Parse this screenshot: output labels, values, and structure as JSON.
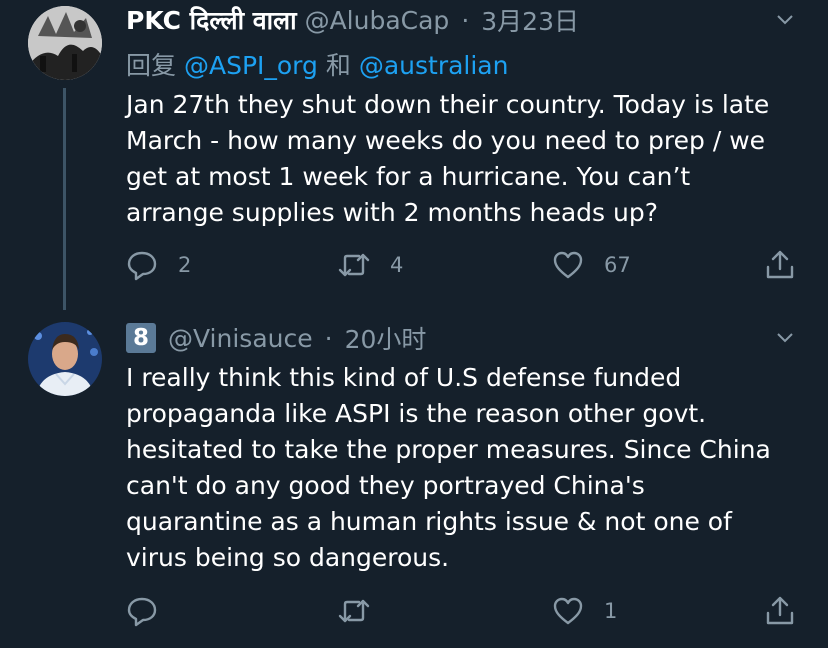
{
  "tweets": [
    {
      "display_name": "PKC दिल्ली वाला",
      "handle": "@AlubaCap",
      "separator": "·",
      "time": "3月23日",
      "reply_prefix": "回复",
      "reply_mention_1": "@ASPI_org",
      "reply_joiner": "和",
      "reply_mention_2": "@australian",
      "text_lines": [
        "Jan 27th they shut down their country. Today is late",
        "March - how many weeks do you need to prep / we",
        "get at most 1 week for a hurricane. You can’t",
        "arrange supplies with 2 months heads up?"
      ],
      "reply_count": "2",
      "retweet_count": "4",
      "like_count": "67"
    },
    {
      "badge": "8",
      "handle": "@Vinisauce",
      "separator": "·",
      "time": "20小时",
      "text_lines": [
        "I really think this kind of U.S defense funded",
        "propaganda like ASPI is the reason other govt.",
        "hesitated to take the proper measures. Since China",
        "can't do any good they portrayed China's",
        "quarantine as a human rights issue & not one of",
        "virus being so dangerous."
      ],
      "reply_count": "",
      "retweet_count": "",
      "like_count": "1"
    }
  ],
  "icons": [
    "reply-icon",
    "retweet-icon",
    "like-icon",
    "share-icon",
    "chevron-down-icon"
  ],
  "colors": {
    "background": "#15202b",
    "text": "#ffffff",
    "muted": "#8899a6",
    "link": "#1da1f2",
    "thread_line": "#3d5466"
  }
}
